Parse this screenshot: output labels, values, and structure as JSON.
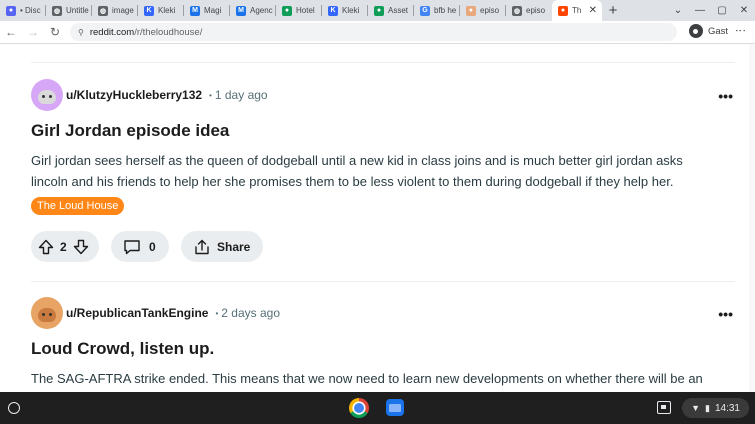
{
  "browser": {
    "tabs": [
      {
        "title": "• Disc",
        "icon": "discord-icon",
        "color": "#5865f2",
        "glyph": "●"
      },
      {
        "title": "Untitle",
        "icon": "globe-icon",
        "color": "#5f6368",
        "glyph": "◍"
      },
      {
        "title": "image",
        "icon": "globe-icon",
        "color": "#5f6368",
        "glyph": "◍"
      },
      {
        "title": "Kleki",
        "icon": "kleki-icon",
        "color": "#3366ff",
        "glyph": "K"
      },
      {
        "title": "Magi",
        "icon": "m-icon",
        "color": "#1a73e8",
        "glyph": "M"
      },
      {
        "title": "Agenc",
        "icon": "m-icon",
        "color": "#1a73e8",
        "glyph": "M"
      },
      {
        "title": "Hotel",
        "icon": "green-icon",
        "color": "#0f9d58",
        "glyph": "●"
      },
      {
        "title": "Kleki",
        "icon": "kleki-icon",
        "color": "#3366ff",
        "glyph": "K"
      },
      {
        "title": "Asset",
        "icon": "green-icon",
        "color": "#0f9d58",
        "glyph": "●"
      },
      {
        "title": "bfb he",
        "icon": "google-icon",
        "color": "#4285f4",
        "glyph": "G"
      },
      {
        "title": "episo",
        "icon": "image-icon",
        "color": "#e8a87c",
        "glyph": "●"
      },
      {
        "title": "episo",
        "icon": "globe-icon",
        "color": "#5f6368",
        "glyph": "◍"
      },
      {
        "title": "Th",
        "icon": "reddit-icon",
        "color": "#ff4500",
        "glyph": "●",
        "active": true
      }
    ],
    "new_tab": "+",
    "url_host": "reddit.com",
    "url_path": "/r/theloudhouse/",
    "profile": "Gast"
  },
  "posts": [
    {
      "author": "u/KlutzyHuckleberry132",
      "time": "1 day ago",
      "avatar_color": "#d7a7f7",
      "title": "Girl Jordan episode idea",
      "body": "Girl jordan sees herself as the queen of dodgeball until a new kid in class joins and is much better girl jordan asks lincoln and his friends to help her she promises them to be less violent to them during dodgeball if they help her.",
      "flair": "The Loud House",
      "votes": "2",
      "comments": "0",
      "share": "Share"
    },
    {
      "author": "u/RepublicanTankEngine",
      "time": "2 days ago",
      "avatar_color": "#e8a464",
      "title": "Loud Crowd, listen up.",
      "body": "The SAG-AFTRA strike ended. This means that we now need to learn new developments on whether there will be an"
    }
  ],
  "shelf": {
    "time": "14:31"
  }
}
